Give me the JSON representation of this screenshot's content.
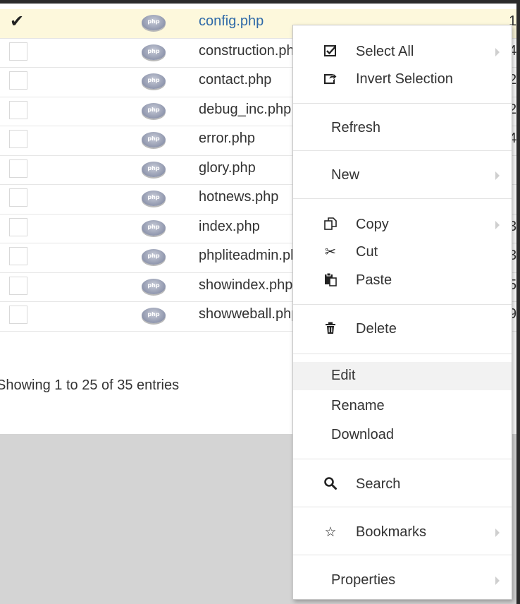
{
  "files": [
    {
      "name": "config.php",
      "size_fragment": "1",
      "selected": true,
      "checked": true,
      "icon_text": "php"
    },
    {
      "name": "construction.php",
      "size_fragment": "4",
      "selected": false,
      "checked": false,
      "icon_text": "php"
    },
    {
      "name": "contact.php",
      "size_fragment": "2",
      "selected": false,
      "checked": false,
      "icon_text": "php"
    },
    {
      "name": "debug_inc.php",
      "size_fragment": "2",
      "selected": false,
      "checked": false,
      "icon_text": "php"
    },
    {
      "name": "error.php",
      "size_fragment": "4",
      "selected": false,
      "checked": false,
      "icon_text": "php"
    },
    {
      "name": "glory.php",
      "size_fragment": "",
      "selected": false,
      "checked": false,
      "icon_text": "php"
    },
    {
      "name": "hotnews.php",
      "size_fragment": "",
      "selected": false,
      "checked": false,
      "icon_text": "php"
    },
    {
      "name": "index.php",
      "size_fragment": "3",
      "selected": false,
      "checked": false,
      "icon_text": "php"
    },
    {
      "name": "phpliteadmin.php",
      "size_fragment": "3",
      "selected": false,
      "checked": false,
      "icon_text": "php"
    },
    {
      "name": "showindex.php",
      "size_fragment": "5",
      "selected": false,
      "checked": false,
      "icon_text": "php"
    },
    {
      "name": "showweball.php",
      "size_fragment": "9",
      "selected": false,
      "checked": false,
      "icon_text": "php"
    }
  ],
  "status": {
    "entries_info": "Showing 1 to 25 of 35 entries"
  },
  "context_menu": {
    "select_all": "Select All",
    "invert_selection": "Invert Selection",
    "refresh": "Refresh",
    "new": "New",
    "copy": "Copy",
    "cut": "Cut",
    "paste": "Paste",
    "delete": "Delete",
    "edit": "Edit",
    "rename": "Rename",
    "download": "Download",
    "search": "Search",
    "bookmarks": "Bookmarks",
    "properties": "Properties"
  },
  "icons": {
    "checked_checkbox": "check-square-icon",
    "invert": "share-square-icon",
    "copy": "copy-icon",
    "cut": "scissors-icon",
    "paste": "paste-icon",
    "delete": "trash-icon",
    "search": "search-icon",
    "bookmarks": "star-outline-icon",
    "file": "php-file-icon",
    "submenu": "submenu-arrow-icon"
  },
  "colors": {
    "selected_row_bg": "#fdf8dc",
    "link_blue": "#2f69a8",
    "menu_hover_bg": "#f2f2f2",
    "empty_area_bg": "#d4d4d4"
  }
}
